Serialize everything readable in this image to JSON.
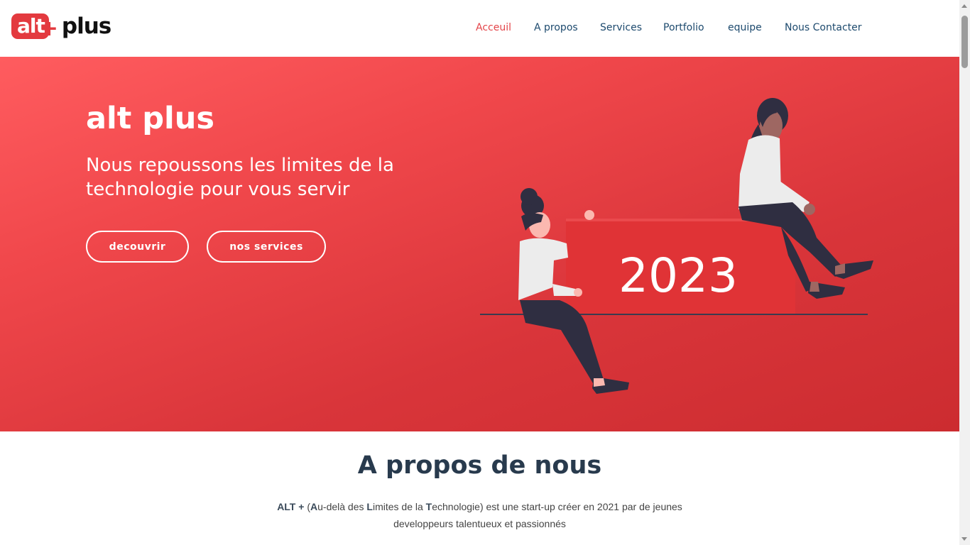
{
  "header": {
    "logo": {
      "box_text": "alt",
      "plus_glyph": "+",
      "text": "plus"
    },
    "nav": [
      {
        "label": "Acceuil",
        "active": true
      },
      {
        "label": "A propos",
        "active": false
      },
      {
        "label": "Services",
        "active": false
      },
      {
        "label": "Portfolio",
        "active": false
      },
      {
        "label": "equipe",
        "active": false
      },
      {
        "label": "Nous Contacter",
        "active": false
      }
    ]
  },
  "hero": {
    "title": "alt plus",
    "subtitle": "Nous repoussons les limites de la technologie pour vous servir",
    "buttons": {
      "primary": "decouvrir",
      "secondary": "nos services"
    },
    "illustration": {
      "sign_text": "2023"
    }
  },
  "about": {
    "title": "A propos de nous",
    "brand": "ALT +",
    "open_paren": " (",
    "acronym": [
      {
        "letter": "A",
        "rest": "u-delà des "
      },
      {
        "letter": "L",
        "rest": "imites de la "
      },
      {
        "letter": "T",
        "rest": "echnologie"
      }
    ],
    "rest": ") est une start-up créer en 2021 par de jeunes developpeurs talentueux et passionnés"
  },
  "colors": {
    "accent": "#e4454a",
    "nav_text": "#1d4a6e",
    "hero_top": "#ff5c5f",
    "hero_bottom": "#cc2c30",
    "sign": "#e03336",
    "dark": "#2f2e41"
  }
}
